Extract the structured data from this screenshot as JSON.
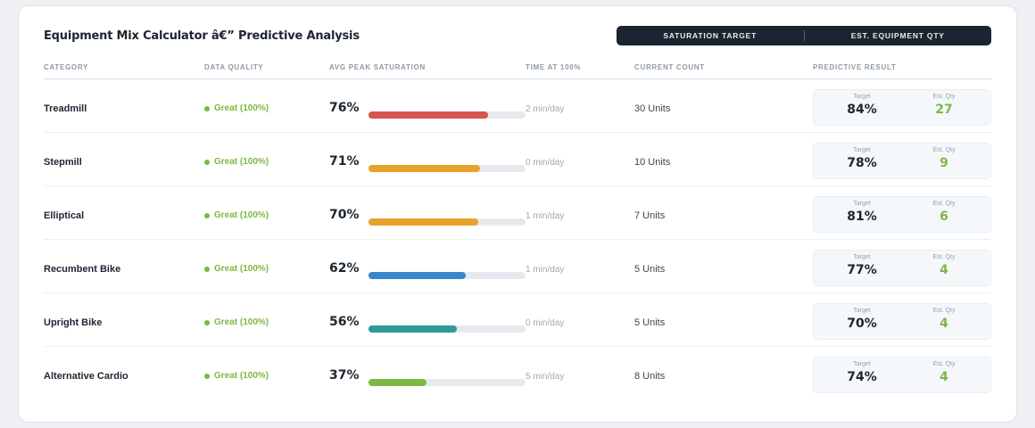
{
  "title": "Equipment Mix Calculator â€” Predictive Analysis",
  "legend": {
    "saturation_target": "SATURATION TARGET",
    "est_equipment_qty": "EST. EQUIPMENT QTY"
  },
  "headers": {
    "category": "CATEGORY",
    "data_quality": "DATA QUALITY",
    "avg_peak_saturation": "AVG PEAK SATURATION",
    "time_at_100": "TIME AT 100%",
    "current_count": "CURRENT COUNT",
    "predictive_result": "PREDICTIVE RESULT"
  },
  "result_labels": {
    "target": "Target",
    "est_qty": "Est. Qty"
  },
  "colors": {
    "red": "#d9534f",
    "orange": "#e8a22a",
    "blue": "#3a86c8",
    "teal": "#2f9b94",
    "green": "#7cb843"
  },
  "rows": [
    {
      "category": "Treadmill",
      "quality": "Great (100%)",
      "saturation": "76%",
      "saturation_value": 76,
      "bar_color": "#d9534f",
      "time": "2 min/day",
      "count": "30 Units",
      "target": "84%",
      "qty": "27"
    },
    {
      "category": "Stepmill",
      "quality": "Great (100%)",
      "saturation": "71%",
      "saturation_value": 71,
      "bar_color": "#e8a22a",
      "time": "0 min/day",
      "count": "10 Units",
      "target": "78%",
      "qty": "9"
    },
    {
      "category": "Elliptical",
      "quality": "Great (100%)",
      "saturation": "70%",
      "saturation_value": 70,
      "bar_color": "#e8a22a",
      "time": "1 min/day",
      "count": "7 Units",
      "target": "81%",
      "qty": "6"
    },
    {
      "category": "Recumbent Bike",
      "quality": "Great (100%)",
      "saturation": "62%",
      "saturation_value": 62,
      "bar_color": "#3a86c8",
      "time": "1 min/day",
      "count": "5 Units",
      "target": "77%",
      "qty": "4"
    },
    {
      "category": "Upright Bike",
      "quality": "Great (100%)",
      "saturation": "56%",
      "saturation_value": 56,
      "bar_color": "#2f9b94",
      "time": "0 min/day",
      "count": "5 Units",
      "target": "70%",
      "qty": "4"
    },
    {
      "category": "Alternative Cardio",
      "quality": "Great (100%)",
      "saturation": "37%",
      "saturation_value": 37,
      "bar_color": "#7cb843",
      "time": "5 min/day",
      "count": "8 Units",
      "target": "74%",
      "qty": "4"
    }
  ]
}
